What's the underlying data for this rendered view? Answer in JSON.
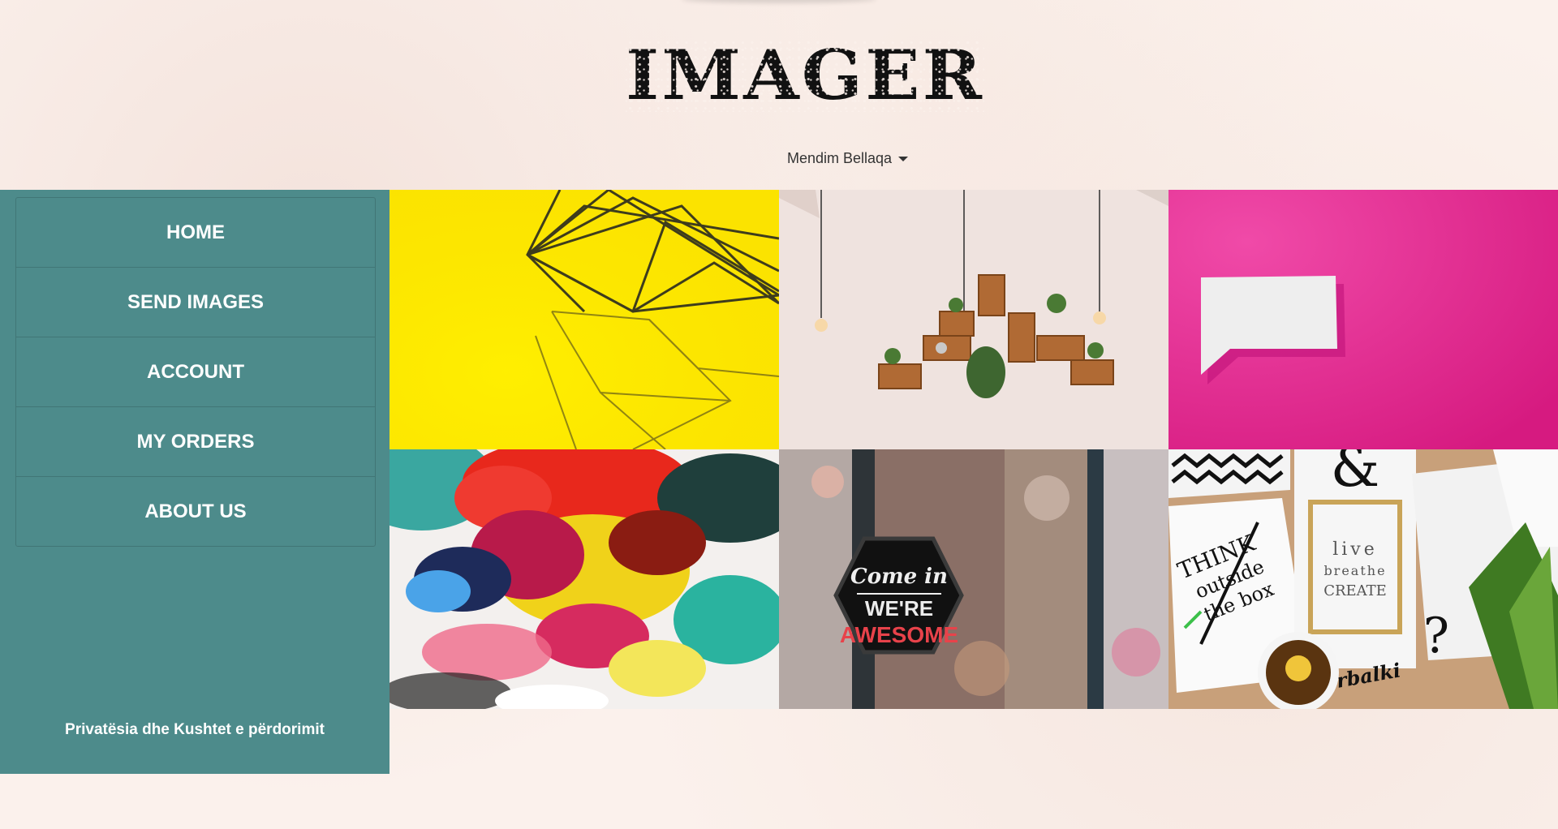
{
  "brand": {
    "logo_text": "IMAGER"
  },
  "user_menu": {
    "name": "Mendim Bellaqa",
    "icon": "caret-down-icon"
  },
  "sidebar": {
    "items": [
      {
        "label": "HOME"
      },
      {
        "label": "SEND IMAGES"
      },
      {
        "label": "ACCOUNT"
      },
      {
        "label": "MY ORDERS"
      },
      {
        "label": "ABOUT US"
      }
    ],
    "footer_link": "Privatësia dhe Kushtet e përdorimit"
  },
  "gallery": {
    "tiles": [
      {
        "subject": "geometric wire sculpture on yellow"
      },
      {
        "subject": "wall shelves with plants and hanging bulbs"
      },
      {
        "subject": "speech bubble card on magenta"
      },
      {
        "subject": "colorful abstract fluid paint"
      },
      {
        "subject": "shop sign",
        "sign_line1": "Come in",
        "sign_line2": "WE'RE",
        "sign_line3": "AWESOME"
      },
      {
        "subject": "typography prints with tea",
        "text_think": "THINK",
        "text_outside": "outside",
        "text_the_box": "the box",
        "text_live": "live",
        "text_breathe": "breathe",
        "text_create": "CREATE",
        "text_brand": "herbalki",
        "text_ampersand": "&",
        "text_q": "?"
      }
    ]
  },
  "colors": {
    "sidebar_bg": "#4d8b8b",
    "page_bg": "#fbf1ec"
  }
}
